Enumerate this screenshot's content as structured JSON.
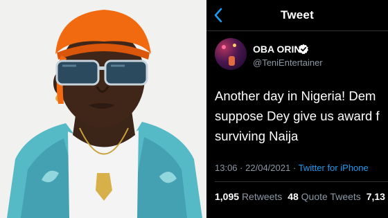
{
  "header": {
    "title": "Tweet",
    "back_icon": "chevron-left-icon"
  },
  "author": {
    "name": "OBA ORIN",
    "handle": "@TeniEntertainer",
    "verified_icon": "verified-badge-icon"
  },
  "tweet": {
    "lines": [
      "Another day in Nigeria! Dem",
      "suppose Dey give us award f",
      "surviving Naija"
    ],
    "time": "13:06",
    "separator": "·",
    "date": "22/04/2021",
    "source": "Twitter for iPhone"
  },
  "stats": {
    "retweets_count": "1,095",
    "retweets_label": "Retweets",
    "quotes_count": "48",
    "quotes_label": "Quote Tweets",
    "likes_count_partial": "7,13"
  },
  "colors": {
    "panel_bg": "#000000",
    "secondary_text": "#8b98a5",
    "link": "#1d9bf0",
    "headwrap": "#f26a10",
    "jacket": "#4fb3c0"
  }
}
